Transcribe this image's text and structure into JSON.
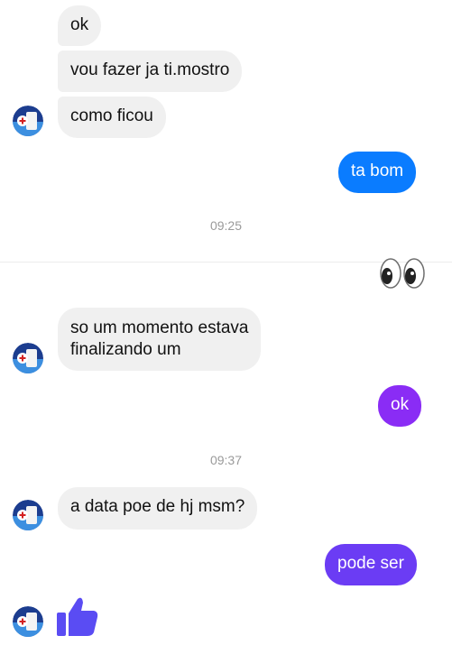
{
  "messages": {
    "m1": "ok",
    "m2": "vou fazer ja ti.mostro",
    "m3": "como ficou",
    "m4": "ta bom",
    "m5_line1": "so um momento estava",
    "m5_line2": "finalizando um",
    "m6": "ok",
    "m7": "a data poe de hj msm?",
    "m8": "pode ser"
  },
  "timestamps": {
    "t1": "09:25",
    "t2": "09:37"
  },
  "reactions": {
    "eyes_emoji": "eyes-icon",
    "like_icon": "thumbs-up-icon"
  },
  "colors": {
    "incoming_bg": "#f0f0f0",
    "outgoing_blue": "#0a7cff",
    "outgoing_purple_1": "#8a2cf5",
    "outgoing_purple_2": "#6b3cf4",
    "like_blue": "#5a4cf3"
  }
}
